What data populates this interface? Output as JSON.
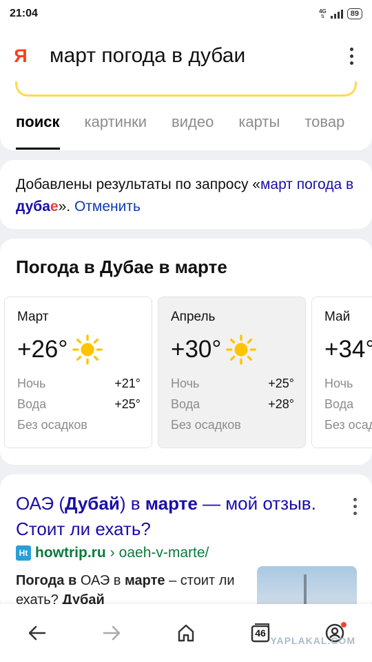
{
  "status_bar": {
    "time": "21:04",
    "network": "4G",
    "battery": "89"
  },
  "search": {
    "logo": "Я",
    "query": "март погода в дубаи"
  },
  "tabs": [
    {
      "label": "поиск",
      "active": true
    },
    {
      "label": "картинки",
      "active": false
    },
    {
      "label": "видео",
      "active": false
    },
    {
      "label": "карты",
      "active": false
    },
    {
      "label": "товар",
      "active": false
    }
  ],
  "notice": {
    "prefix": "Добавлены результаты по запросу «",
    "link_start": "март погода в ",
    "link_bold": "дуба",
    "link_highlight": "е",
    "suffix": "». ",
    "cancel": "Отменить"
  },
  "weather": {
    "title": "Погода в Дубае в марте",
    "night_label": "Ночь",
    "water_label": "Вода",
    "months": [
      {
        "name": "Март",
        "temp": "+26°",
        "night": "+21°",
        "water": "+25°",
        "precip": "Без осадков",
        "icon": "sun-icon"
      },
      {
        "name": "Апрель",
        "temp": "+30°",
        "night": "+25°",
        "water": "+28°",
        "precip": "Без осадков",
        "icon": "sun-icon"
      },
      {
        "name": "Май",
        "temp": "+34°",
        "night": "",
        "water": "",
        "precip": "Без осадков",
        "icon": ""
      }
    ]
  },
  "result": {
    "title_p1": "ОАЭ (",
    "title_bold": "Дубай",
    "title_p2": ") в ",
    "title_bold2": "марте",
    "title_p3": " — мой отзыв. Стоит ли ехать?",
    "favicon": "Ht",
    "domain": "howtrip.ru",
    "separator": " › ",
    "path": "oaeh-v-marte/",
    "snippet_p1": "Погода в ",
    "snippet_p2": "ОАЭ в ",
    "snippet_bold": "марте",
    "snippet_p3": " – стоит ли ехать? ",
    "snippet_bold2": "Дубай"
  },
  "bottom_nav": {
    "tab_count": "46"
  },
  "watermark": "YAPLAKAL.COM",
  "colors": {
    "brand": "#fc3f1d",
    "link": "#1a0dab",
    "url_green": "#0a7a3a",
    "highlight": "#e04242",
    "search_border": "#ffdb4d"
  }
}
